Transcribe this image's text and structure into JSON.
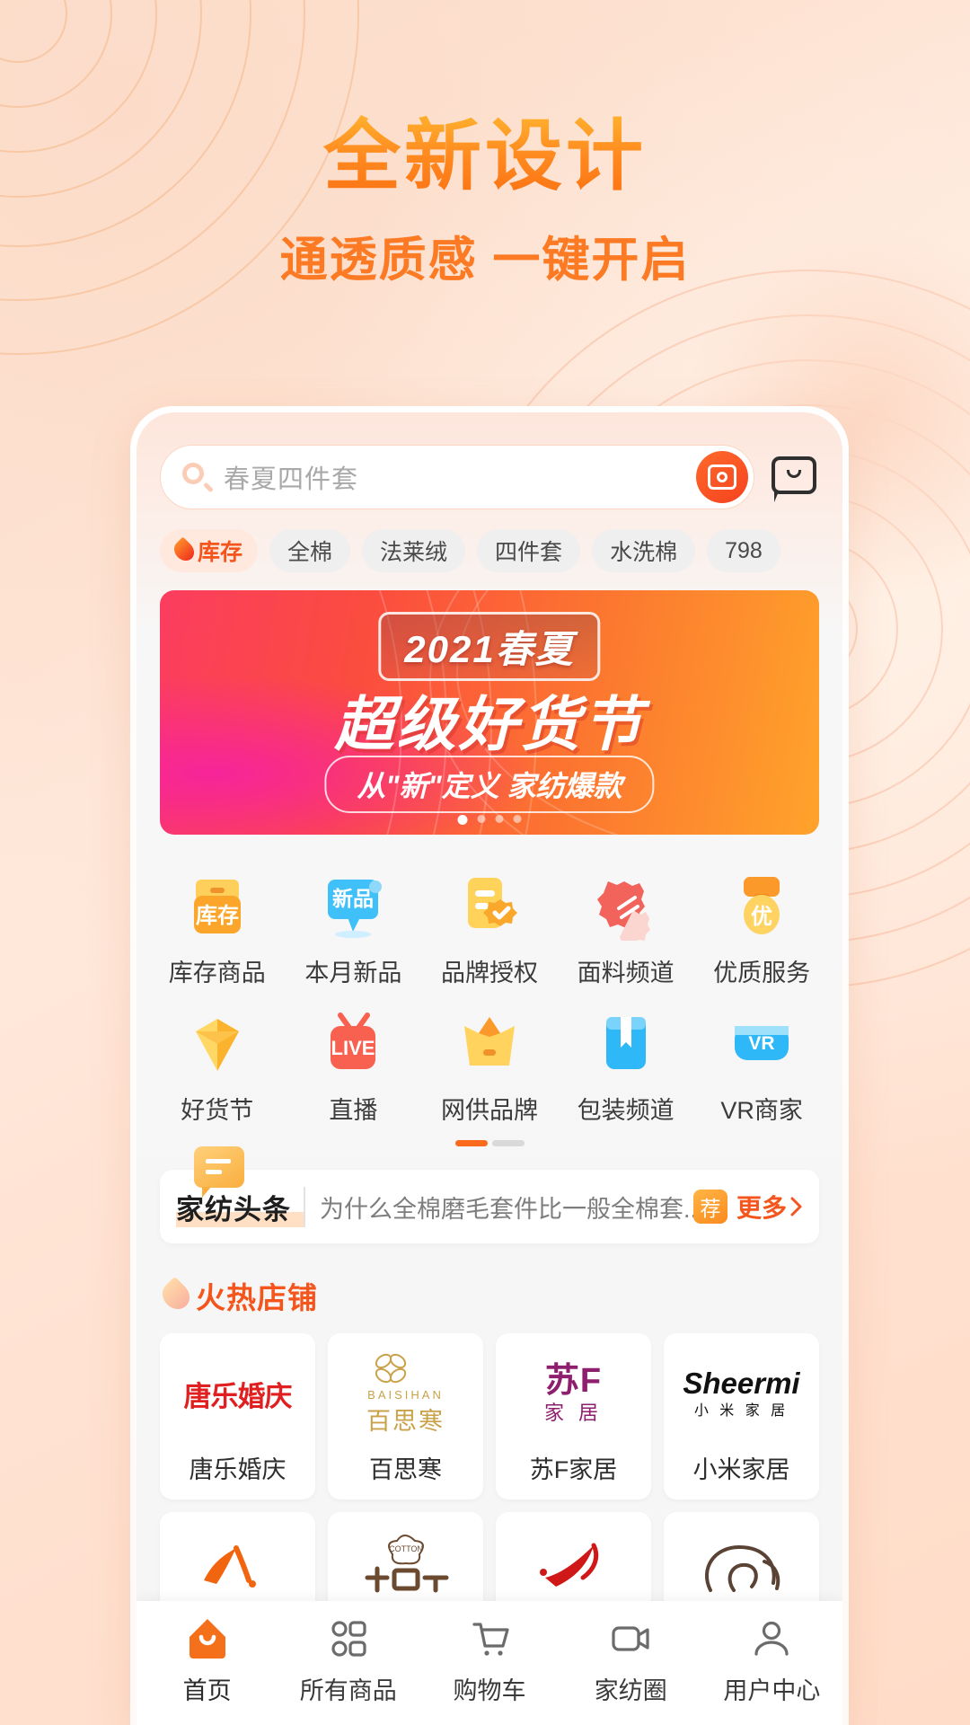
{
  "promo": {
    "title": "全新设计",
    "subtitle": "通透质感 一键开启"
  },
  "search": {
    "placeholder": "春夏四件套",
    "search_icon": "search-icon",
    "camera_icon": "camera-icon",
    "chat_icon": "chat-bubble-icon"
  },
  "chips": [
    {
      "label": "库存",
      "active": true,
      "icon": "flame-icon"
    },
    {
      "label": "全棉",
      "active": false
    },
    {
      "label": "法莱绒",
      "active": false
    },
    {
      "label": "四件套",
      "active": false
    },
    {
      "label": "水洗棉",
      "active": false
    },
    {
      "label": "798",
      "active": false
    }
  ],
  "banner": {
    "badge": "2021春夏",
    "headline": "超级好货节",
    "tagline": "从\"新\"定义 家纺爆款",
    "dots": 4,
    "active_dot": 1
  },
  "grid": {
    "row1": [
      {
        "label": "库存商品",
        "icon": "inventory-box-icon",
        "badge": "库存"
      },
      {
        "label": "本月新品",
        "icon": "new-product-bubble-icon",
        "badge": "新品"
      },
      {
        "label": "品牌授权",
        "icon": "brand-certificate-icon"
      },
      {
        "label": "面料频道",
        "icon": "fabric-swatch-icon"
      },
      {
        "label": "优质服务",
        "icon": "quality-medal-icon",
        "badge": "优"
      }
    ],
    "row2": [
      {
        "label": "好货节",
        "icon": "gem-diamond-icon"
      },
      {
        "label": "直播",
        "icon": "live-tv-icon",
        "badge": "LIVE"
      },
      {
        "label": "网供品牌",
        "icon": "crown-icon"
      },
      {
        "label": "包装频道",
        "icon": "package-box-icon"
      },
      {
        "label": "VR商家",
        "icon": "vr-headset-icon",
        "badge": "VR"
      }
    ],
    "pages": 2,
    "active_page": 1
  },
  "news": {
    "flag_icon": "speech-flag-icon",
    "title": "家纺头条",
    "text": "为什么全棉磨毛套件比一般全棉套...",
    "tag": "荐",
    "more": "更多",
    "chevron": "chevron-right-icon"
  },
  "shops_section": {
    "icon": "flame-icon",
    "title": "火热店铺",
    "items": [
      {
        "name": "唐乐婚庆",
        "logo_text": "唐乐婚庆",
        "logo_color": "#e02020"
      },
      {
        "name": "百思寒",
        "logo_text": "百思寒",
        "logo_sub": "BAISIHAN",
        "logo_color": "#c9a24a"
      },
      {
        "name": "苏F家居",
        "logo_text": "苏F",
        "logo_sub": "家 居",
        "logo_color": "#8e1f6e"
      },
      {
        "name": "小米家居",
        "logo_text": "Sheermi",
        "logo_sub": "小 米 家 居",
        "logo_color": "#111111"
      }
    ],
    "items_row2": [
      {
        "name": "shop-logo-orange",
        "logo_color": "#f2650f"
      },
      {
        "name": "shop-logo-cotton",
        "logo_color": "#6b4a30",
        "logo_sub": "COTTON"
      },
      {
        "name": "shop-logo-red",
        "logo_color": "#d01818"
      },
      {
        "name": "shop-logo-brown",
        "logo_color": "#5a4334"
      }
    ]
  },
  "tabbar": [
    {
      "label": "首页",
      "icon": "home-icon",
      "active": true
    },
    {
      "label": "所有商品",
      "icon": "grid-apps-icon",
      "active": false
    },
    {
      "label": "购物车",
      "icon": "shopping-cart-icon",
      "active": false
    },
    {
      "label": "家纺圈",
      "icon": "video-camera-icon",
      "active": false
    },
    {
      "label": "用户中心",
      "icon": "user-profile-icon",
      "active": false
    }
  ],
  "colors": {
    "accent": "#f4551c",
    "brand_orange": "#fb7314",
    "page_bg": "#fde3d3"
  }
}
